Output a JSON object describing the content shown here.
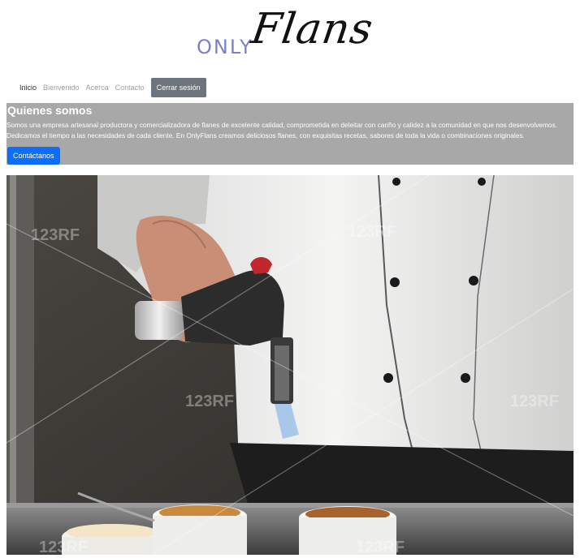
{
  "logo": {
    "only": "ONLY",
    "flans": "Flans"
  },
  "nav": {
    "items": [
      "Inicio",
      "Bienvenido",
      "Acerca",
      "Contacto"
    ],
    "logout": "Cerrar sesión"
  },
  "about": {
    "title": "Quienes somos",
    "text": "Somos una empresa artesanal productora y comercializadora de flanes de excelente calidad, comprometida en deleitar con cariño y calidez a la comunidad en que nos desenvolvemos. Dedicamos el tiempo a las necesidades de cada cliente. En OnlyFlans creamos deliciosos flanes, con exquisitas recetas, sabores de toda la vida o combinaciones originales.",
    "button": "Contáctanos"
  },
  "hero": {
    "alt": "Chef caramelizando flanes con un soplete",
    "watermark": "123RF"
  },
  "colors": {
    "about_bg": "#a8a8a8",
    "primary": "#0d6efd",
    "secondary": "#6c757d",
    "logo_accent": "#7d80c8"
  }
}
